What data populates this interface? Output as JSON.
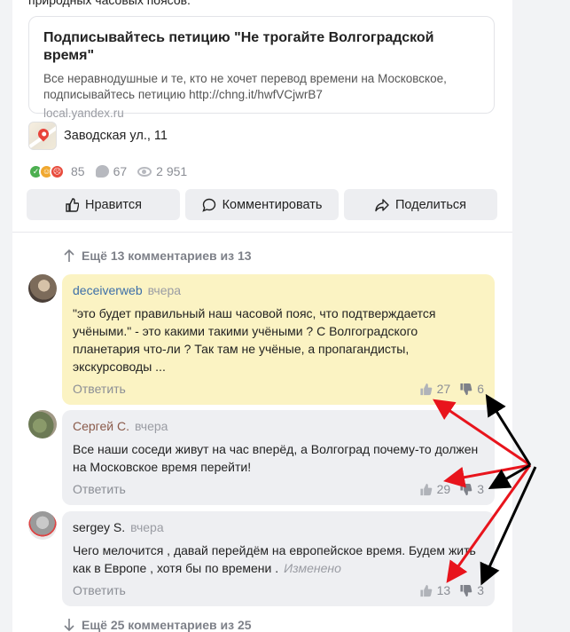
{
  "post": {
    "cut_text": "природных часовых поясов.",
    "link": {
      "title": "Подписывайтесь петицию \"Не трогайте Волгоградской время\"",
      "description": "Все неравнодушные и те, кто не хочет перевод времени на Московское, подписывайтесь петицию http://chng.it/hwfVCjwrB7",
      "domain": "local.yandex.ru"
    },
    "place": "Заводская ул., 11",
    "stats": {
      "reactions": "85",
      "comments": "67",
      "views": "2 951"
    },
    "actions": {
      "like": "Нравится",
      "comment": "Комментировать",
      "share": "Поделиться"
    }
  },
  "more_top": "Ещё 13 комментариев из 13",
  "more_bottom": "Ещё 25 комментариев из 25",
  "comments": [
    {
      "author": "deceiverweb",
      "time": "вчера",
      "text": "\"это будет правильный наш часовой пояс, что подтверждается учёными.\" - это какими такими учёными ? С Волгоградского планетария что-ли ? Так там не учёные, а пропагандисты, экскурсоводы ...",
      "reply": "Ответить",
      "likes": "27",
      "dislikes": "6"
    },
    {
      "author": "Сергей С.",
      "time": "вчера",
      "text": "Все наши соседи живут на час вперёд, а Волгоград почему-то должен на Московское время перейти!",
      "reply": "Ответить",
      "likes": "29",
      "dislikes": "3"
    },
    {
      "author": "sergey S.",
      "time": "вчера",
      "text": "Чего мелочится , давай перейдём на европейское время. Будем жить как в Европе , хотя бы по времени .",
      "edited": "Изменено",
      "reply": "Ответить",
      "likes": "13",
      "dislikes": "3"
    }
  ],
  "colors": {
    "accent": "#3d6fa8",
    "highlight_bg": "#fbf3c3",
    "arrow_red": "#e8141c",
    "arrow_black": "#000000"
  }
}
